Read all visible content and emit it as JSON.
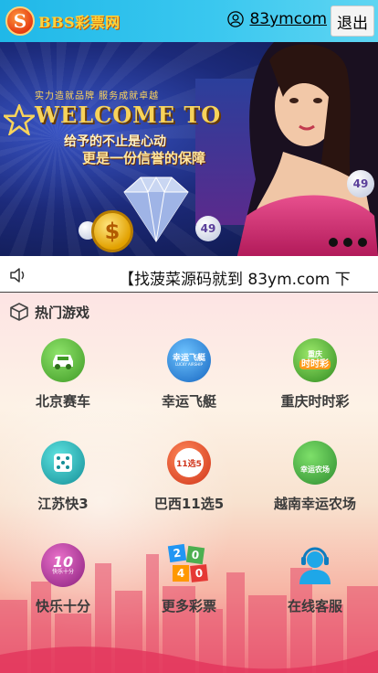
{
  "header": {
    "logo_text": "BBS彩票网",
    "username": "83ymcom",
    "logout_label": "退出",
    "bg_color": "#2bbde9"
  },
  "banner": {
    "slogan_top": "实力造就品牌 服务成就卓越",
    "welcome": "WELCOME TO",
    "sub1": "给予的不止是心动",
    "sub2": "更是一份信誉的保障",
    "coin_symbol": "$",
    "ball_1": "49",
    "ball_2": "49"
  },
  "marquee": {
    "text": "【找菠菜源码就到 83ym.com 下"
  },
  "hot_games": {
    "title": "热门游戏",
    "items": [
      {
        "label": "北京赛车",
        "icon": "car-icon"
      },
      {
        "label": "幸运飞艇",
        "icon": "airship-icon",
        "badge": "幸运飞艇",
        "badge_sub": "LUCKY AIRSHIP"
      },
      {
        "label": "重庆时时彩",
        "icon": "lottery-icon",
        "badge": "重庆",
        "badge_sub": "时时彩"
      },
      {
        "label": "江苏快3",
        "icon": "dice-icon"
      },
      {
        "label": "巴西11选5",
        "icon": "eleven-five-icon",
        "badge": "11选5"
      },
      {
        "label": "越南幸运农场",
        "icon": "farm-icon",
        "badge": "幸运农场"
      },
      {
        "label": "快乐十分",
        "icon": "happy-ten-icon",
        "badge": "10",
        "badge_sub": "快乐十分"
      },
      {
        "label": "更多彩票",
        "icon": "more-lottery-icon",
        "tiles": [
          "2",
          "0",
          "4",
          "0"
        ]
      },
      {
        "label": "在线客服",
        "icon": "customer-service-icon"
      }
    ]
  }
}
